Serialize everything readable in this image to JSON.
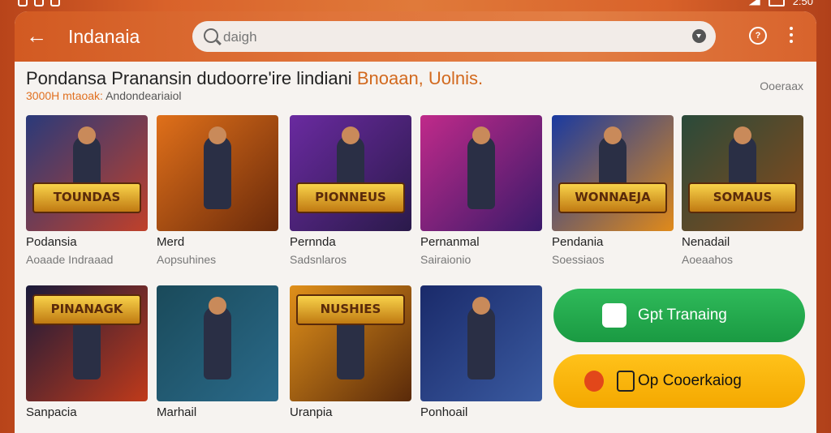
{
  "status_bar": {
    "time": "2:50"
  },
  "app_bar": {
    "title": "Indanaia",
    "search_placeholder": "daigh"
  },
  "section": {
    "headline": "Pondansa Pranansin dudoorre'ire lindiani",
    "headline_highlight": "Bnoaan, Uolnis.",
    "subline_highlight": "3000H mtaoak:",
    "subline": "Andondeariaiol",
    "more_link": "Ooeraax"
  },
  "tiles": [
    {
      "name": "Podansia",
      "sub": "Aoaade Indraaad",
      "logo": "TOUNDAS",
      "colors": [
        "#2a3a7a",
        "#c0402a"
      ]
    },
    {
      "name": "Merd",
      "sub": "Aopsuhines",
      "logo": "",
      "colors": [
        "#e0701a",
        "#6a2a0a"
      ]
    },
    {
      "name": "Pernnda",
      "sub": "Sadsnlaros",
      "logo": "PIONNEUS",
      "colors": [
        "#6a2aa0",
        "#2a1a4a"
      ]
    },
    {
      "name": "Pernanmal",
      "sub": "Sairaionio",
      "logo": "",
      "colors": [
        "#c02a8a",
        "#3a1a6a"
      ]
    },
    {
      "name": "Pendania",
      "sub": "Soessiaos",
      "logo": "WONNAEJA",
      "colors": [
        "#1a3aa0",
        "#e08a1a"
      ]
    },
    {
      "name": "Nenadail",
      "sub": "Aoeaahos",
      "logo": "SOMAUS",
      "colors": [
        "#2a4a3a",
        "#8a4a1a"
      ]
    },
    {
      "name": "Sanpacia",
      "sub": "",
      "logo": "PINANAGK",
      "colors": [
        "#1a1a3a",
        "#c03a1a"
      ]
    },
    {
      "name": "Marhail",
      "sub": "",
      "logo": "",
      "colors": [
        "#1a4a5a",
        "#2a6a8a"
      ]
    },
    {
      "name": "Uranpia",
      "sub": "",
      "logo": "NUSHIES",
      "colors": [
        "#e0901a",
        "#5a2a0a"
      ]
    },
    {
      "name": "Ponhoail",
      "sub": "",
      "logo": "",
      "colors": [
        "#1a2a6a",
        "#3a5aa0"
      ]
    }
  ],
  "buttons": {
    "primary": {
      "label": "Gpt Tranaing",
      "color": "#1fa84a"
    },
    "secondary": {
      "label": "Op Cooerkaiog",
      "color": "#ffb80a"
    }
  }
}
